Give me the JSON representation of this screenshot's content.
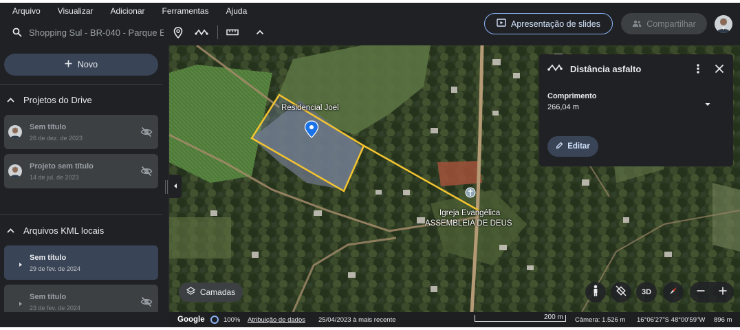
{
  "menu": [
    "Arquivo",
    "Visualizar",
    "Adicionar",
    "Ferramentas",
    "Ajuda"
  ],
  "search": {
    "value": "Shopping Sul - BR-040 - Parque E"
  },
  "toolbar": {
    "icons": [
      "search-icon",
      "placemark-icon",
      "path-icon",
      "ruler-icon",
      "chevron-up-icon"
    ],
    "slides_label": "Apresentação de slides",
    "share_label": "Compartilhar"
  },
  "sidebar": {
    "new_label": "Novo",
    "drive_section": {
      "title": "Projetos do Drive",
      "items": [
        {
          "title": "Sem título",
          "date": "26 de dez. de 2023"
        },
        {
          "title": "Projeto sem título",
          "date": "14 de jul. de 2023"
        }
      ]
    },
    "kml_section": {
      "title": "Arquivos KML locais",
      "items": [
        {
          "title": "Sem título",
          "date": "29 de fev. de 2024"
        },
        {
          "title": "Sem título",
          "date": "23 de fev. de 2024"
        }
      ]
    }
  },
  "map": {
    "labels": {
      "residencial": "Residencial Joel",
      "igreja_1": "Igreja Evangélica",
      "igreja_2": "ASSEMBLEIA DE DEUS"
    },
    "layers_label": "Camadas",
    "view_3d_label": "3D"
  },
  "distance_panel": {
    "title": "Distância asfalto",
    "length_label": "Comprimento",
    "length_value": "266,04 m",
    "edit_label": "Editar"
  },
  "status": {
    "logo": "Google",
    "load_pct": "100%",
    "data_attr": "Atribuição de dados",
    "imagery_date": "25/04/2023 à mais recente",
    "scale": "200 m",
    "camera": "Câmera: 1.526 m",
    "coords": "16°06'27\"S 48°00'59\"W",
    "elevation": "896 m"
  },
  "colors": {
    "accent": "#8ab4f8",
    "path": "#f4c430",
    "panel": "#202124",
    "button": "#394457"
  }
}
